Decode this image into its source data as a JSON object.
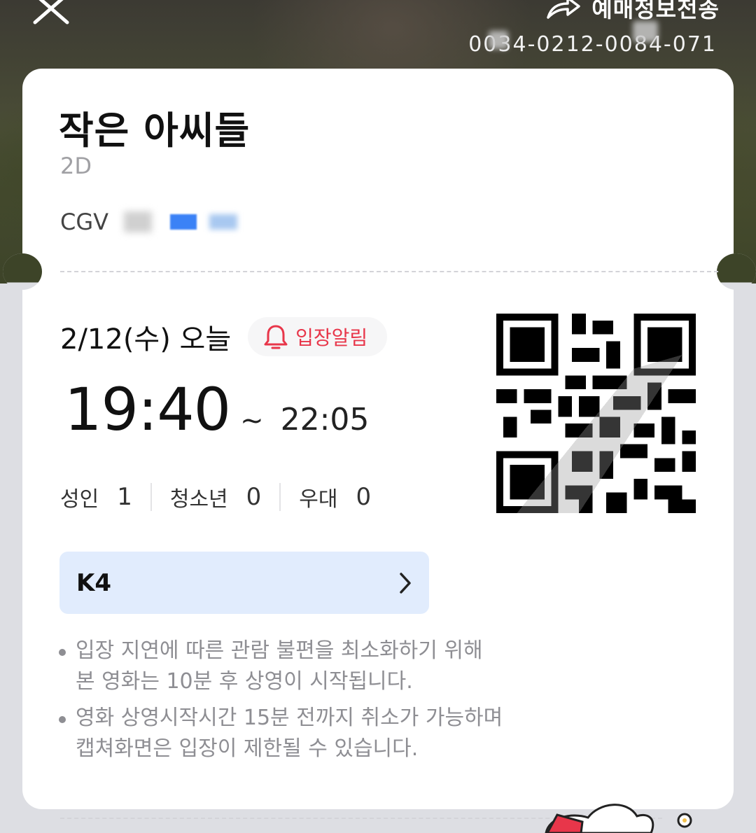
{
  "header": {
    "share_label": "예매정보전송",
    "booking_number": "0034-0212-0084-071"
  },
  "movie": {
    "title": "작은 아씨들",
    "format": "2D",
    "theater_prefix": "CGV"
  },
  "schedule": {
    "date_label": "2/12(수) 오늘",
    "alert_label": "입장알림",
    "start_time": "19:40",
    "separator": "~",
    "end_time": "22:05"
  },
  "counts": [
    {
      "label": "성인",
      "value": "1"
    },
    {
      "label": "청소년",
      "value": "0"
    },
    {
      "label": "우대",
      "value": "0"
    }
  ],
  "seat": {
    "label": "K4"
  },
  "notes": [
    {
      "line1": "입장 지연에 따른 관람 불편을 최소화하기 위해",
      "line2": "본 영화는 10분 후 상영이 시작됩니다."
    },
    {
      "line1": "영화 상영시작시간 15분 전까지 취소가 가능하며",
      "line2": "캡쳐화면은 입장이 제한될 수 있습니다."
    }
  ],
  "colors": {
    "accent_red": "#e8364a",
    "seat_bg": "#e1ecfd",
    "page_bg": "#dddee3"
  },
  "icons": {
    "close": "close-icon",
    "share": "share-arrow-icon",
    "bell": "bell-icon",
    "chevron": "chevron-right-icon"
  }
}
